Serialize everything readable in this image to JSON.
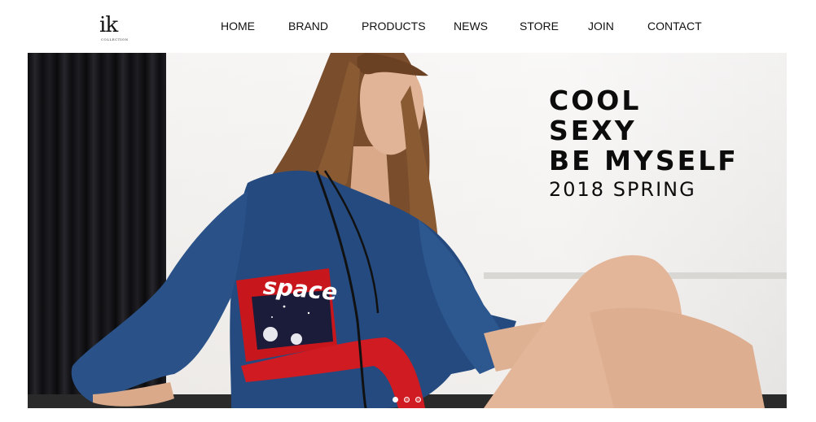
{
  "logo": {
    "mark": "ik",
    "sub": "COLLECTION"
  },
  "nav": {
    "items": [
      {
        "label": "HOME"
      },
      {
        "label": "BRAND"
      },
      {
        "label": "PRODUCTS"
      },
      {
        "label": "NEWS"
      },
      {
        "label": "STORE"
      },
      {
        "label": "JOIN"
      },
      {
        "label": "CONTACT"
      }
    ]
  },
  "hero": {
    "headline": [
      "COOL",
      "SEXY",
      "BE MYSELF"
    ],
    "subline": "2018 SPRING",
    "shirt_print": "space",
    "slider": {
      "count": 3,
      "active": 0
    }
  },
  "colors": {
    "text": "#111111",
    "denim": "#244a7f",
    "accent_red": "#c8161d",
    "curtain": "#111114"
  }
}
